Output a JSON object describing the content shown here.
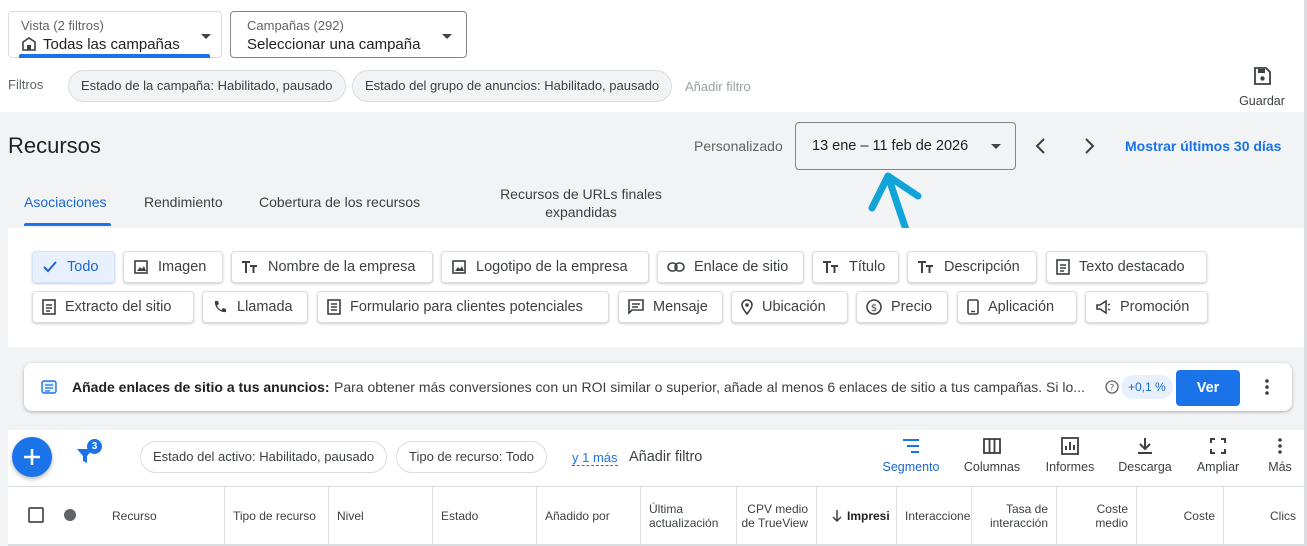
{
  "view_selector": {
    "label": "Vista (2 filtros)",
    "value": "Todas las campañas"
  },
  "campaign_selector": {
    "label": "Campañas (292)",
    "value": "Seleccionar una campaña"
  },
  "filters": {
    "label": "Filtros",
    "chips": [
      "Estado de la campaña: Habilitado, pausado",
      "Estado del grupo de anuncios: Habilitado, pausado"
    ],
    "add_filter": "Añadir filtro"
  },
  "save_label": "Guardar",
  "page_title": "Recursos",
  "date": {
    "preset": "Personalizado",
    "range": "13 ene – 11 feb de 2026",
    "show_last": "Mostrar últimos 30 días"
  },
  "tabs": [
    {
      "label": "Asociaciones",
      "active": true
    },
    {
      "label": "Rendimiento"
    },
    {
      "label": "Cobertura de los recursos"
    },
    {
      "label": "Recursos de URLs finales expandidas"
    }
  ],
  "asset_types": [
    {
      "label": "Todo",
      "icon": "check-icon",
      "active": true
    },
    {
      "label": "Imagen",
      "icon": "image-icon"
    },
    {
      "label": "Nombre de la empresa",
      "icon": "text-size-icon"
    },
    {
      "label": "Logotipo de la empresa",
      "icon": "image-icon"
    },
    {
      "label": "Enlace de sitio",
      "icon": "link-icon"
    },
    {
      "label": "Título",
      "icon": "text-size-icon"
    },
    {
      "label": "Descripción",
      "icon": "text-size-icon"
    },
    {
      "label": "Texto destacado",
      "icon": "document-icon"
    },
    {
      "label": "Extracto del sitio",
      "icon": "document-icon"
    },
    {
      "label": "Llamada",
      "icon": "phone-icon"
    },
    {
      "label": "Formulario para clientes potenciales",
      "icon": "form-icon"
    },
    {
      "label": "Mensaje",
      "icon": "message-icon"
    },
    {
      "label": "Ubicación",
      "icon": "location-pin-icon"
    },
    {
      "label": "Precio",
      "icon": "price-icon"
    },
    {
      "label": "Aplicación",
      "icon": "mobile-icon"
    },
    {
      "label": "Promoción",
      "icon": "megaphone-icon"
    }
  ],
  "recommendation": {
    "title": "Añade enlaces de sitio a tus anuncios:",
    "text": "Para obtener más conversiones con un ROI similar o superior, añade al menos 6 enlaces de sitio a tus campañas. Si lo...",
    "uplift": "+0,1 %",
    "button": "Ver"
  },
  "table_filters": {
    "filter_count": "3",
    "chips": [
      "Estado del activo: Habilitado, pausado",
      "Tipo de recurso: Todo"
    ],
    "more": "y 1 más",
    "add_filter": "Añadir filtro"
  },
  "toolbar": [
    {
      "label": "Segmento",
      "icon": "segment-icon",
      "active": true
    },
    {
      "label": "Columnas",
      "icon": "columns-icon"
    },
    {
      "label": "Informes",
      "icon": "reports-icon"
    },
    {
      "label": "Descarga",
      "icon": "download-icon"
    },
    {
      "label": "Ampliar",
      "icon": "fullscreen-icon"
    },
    {
      "label": "Más",
      "icon": "more-vert-icon"
    }
  ],
  "columns": [
    "Recurso",
    "Tipo de recurso",
    "Nivel",
    "Estado",
    "Añadido por",
    "Última actualización",
    "CPV medio de TrueView",
    "Impresi",
    "Interacciones",
    "Tasa de interacción",
    "Coste medio",
    "Coste",
    "Clics"
  ],
  "colors": {
    "accent": "#1a73e8",
    "annotation_arrow": "#12a4d9"
  }
}
